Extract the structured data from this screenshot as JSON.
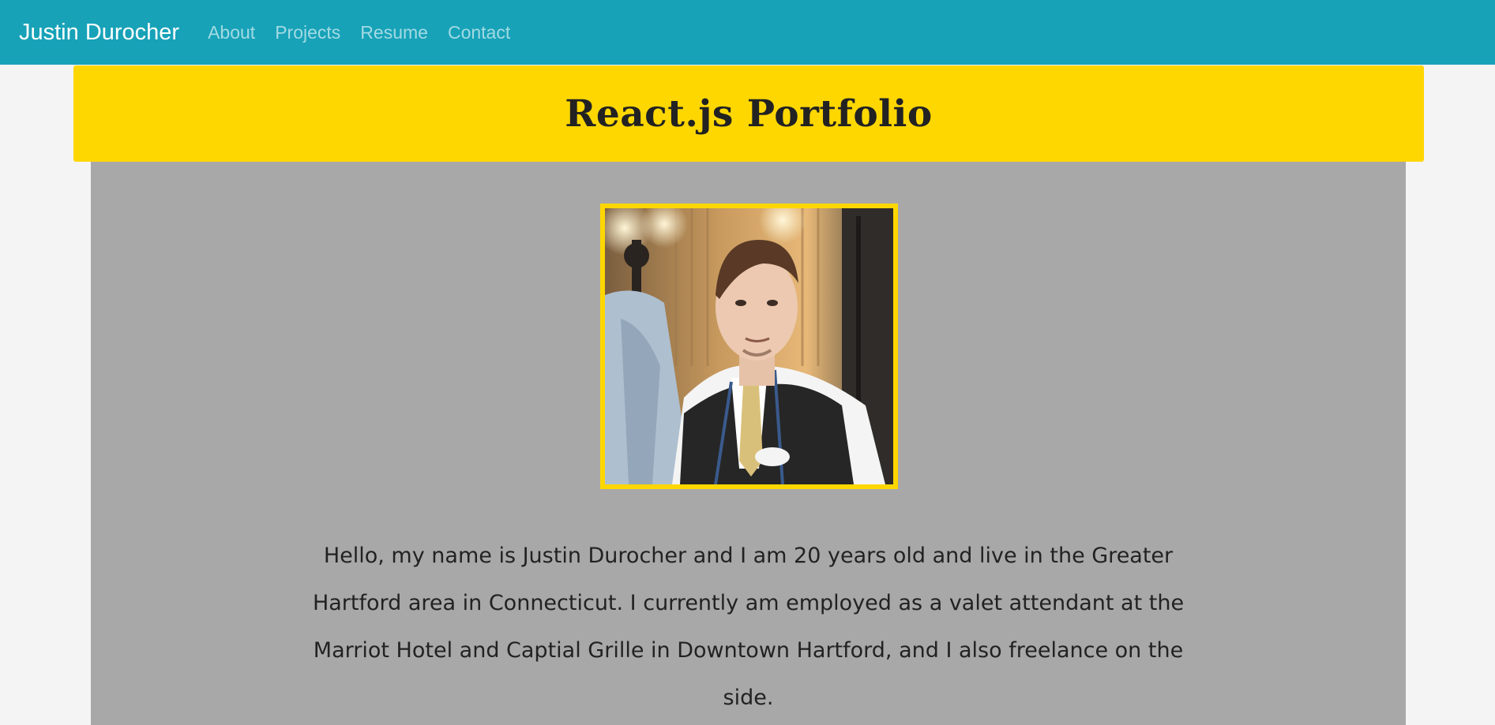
{
  "navbar": {
    "brand": "Justin Durocher",
    "links": [
      "About",
      "Projects",
      "Resume",
      "Contact"
    ]
  },
  "hero": {
    "title": "React.js Portfolio"
  },
  "about": {
    "photo_alt": "profile-photo",
    "bio": "Hello, my name is Justin Durocher and I am 20 years old and live in the Greater Hartford area in Connecticut. I currently am employed as a valet attendant at the Marriot Hotel and Captial Grille in Downtown Hartford, and I also freelance on the side."
  },
  "colors": {
    "navbar": "#17a2b8",
    "hero": "#ffd700",
    "content_bg": "#a8a8a8",
    "page_bg": "#f4f4f4"
  }
}
